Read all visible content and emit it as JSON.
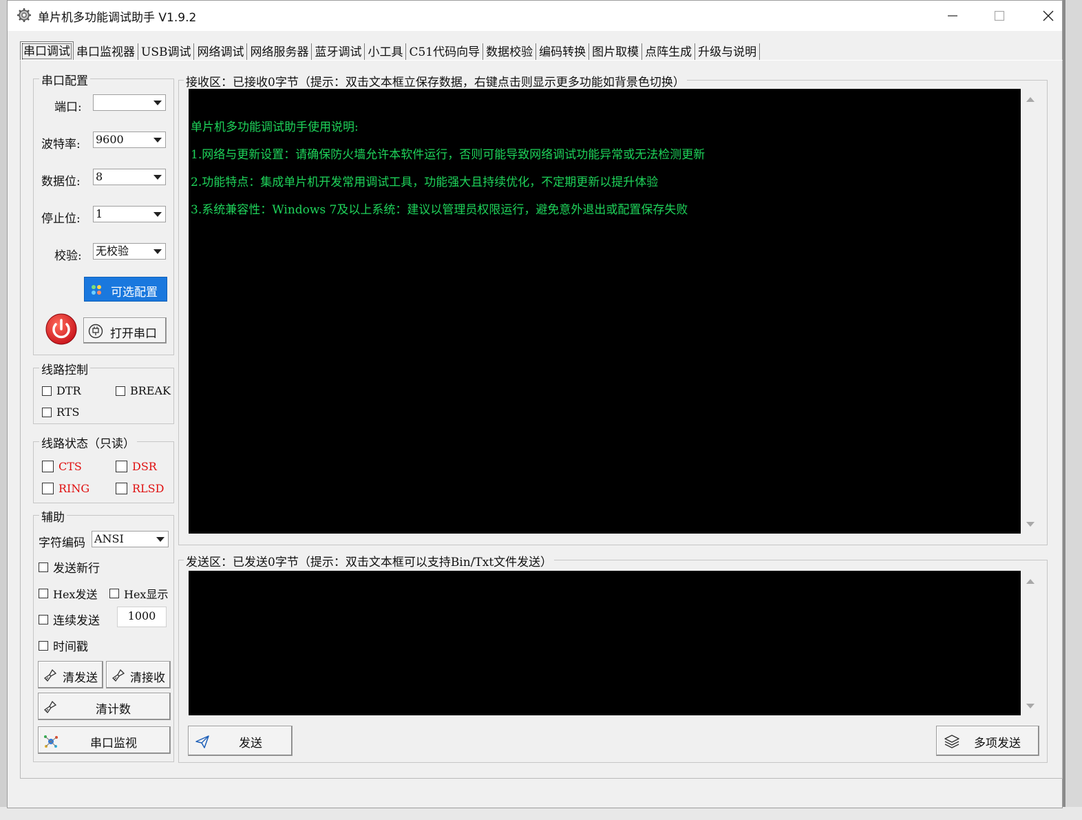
{
  "window": {
    "title": "单片机多功能调试助手 V1.9.2"
  },
  "tabs": [
    "串口调试",
    "串口监视器",
    "USB调试",
    "网络调试",
    "网络服务器",
    "蓝牙调试",
    "小工具",
    "C51代码向导",
    "数据校验",
    "编码转换",
    "图片取模",
    "点阵生成",
    "升级与说明"
  ],
  "serial_config": {
    "title": "串口配置",
    "port_label": "端口:",
    "port_value": "",
    "baud_label": "波特率:",
    "baud_value": "9600",
    "databits_label": "数据位:",
    "databits_value": "8",
    "stopbits_label": "停止位:",
    "stopbits_value": "1",
    "parity_label": "校验:",
    "parity_value": "无校验",
    "optional_button": "可选配置",
    "open_button": "打开串口"
  },
  "line_control": {
    "title": "线路控制",
    "dtr": "DTR",
    "break": "BREAK",
    "rts": "RTS"
  },
  "line_status": {
    "title": "线路状态（只读）",
    "cts": "CTS",
    "dsr": "DSR",
    "ring": "RING",
    "rlsd": "RLSD"
  },
  "aux": {
    "title": "辅助",
    "encoding_label": "字符编码",
    "encoding_value": "ANSI",
    "send_newline": "发送新行",
    "hex_send": "Hex发送",
    "hex_display": "Hex显示",
    "continuous_send": "连续发送",
    "interval_value": "1000",
    "timestamp": "时间戳",
    "clear_send": "清发送",
    "clear_receive": "清接收",
    "clear_count": "清计数",
    "serial_monitor": "串口监视"
  },
  "receive": {
    "title": "接收区：已接收0字节（提示：双击文本框立保存数据，右键点击则显示更多功能如背景色切换）",
    "lines": [
      "单片机多功能调试助手使用说明:",
      "1.网络与更新设置：请确保防火墙允许本软件运行，否则可能导致网络调试功能异常或无法检测更新",
      "2.功能特点：集成单片机开发常用调试工具，功能强大且持续优化，不定期更新以提升体验",
      "3.系统兼容性：Windows 7及以上系统：建议以管理员权限运行，避免意外退出或配置保存失败"
    ]
  },
  "send": {
    "title": "发送区：已发送0字节（提示：双击文本框可以支持Bin/Txt文件发送）",
    "send_button": "发送",
    "multi_send_button": "多项发送"
  }
}
